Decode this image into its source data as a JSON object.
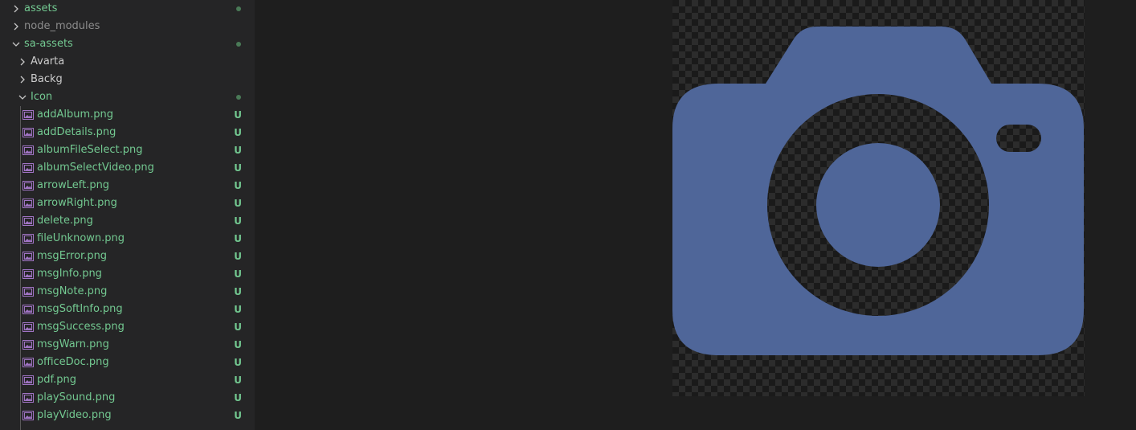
{
  "explorer": {
    "folders": [
      {
        "label": "assets",
        "expanded": false,
        "modified": true
      },
      {
        "label": "node_modules",
        "expanded": false,
        "modified": false
      },
      {
        "label": "sa-assets",
        "expanded": true,
        "modified": true
      }
    ],
    "subfolders": [
      {
        "label": "Avarta",
        "expanded": false
      },
      {
        "label": "Backg",
        "expanded": false
      },
      {
        "label": "Icon",
        "expanded": true,
        "modified": true
      }
    ],
    "files": [
      {
        "name": "addAlbum.png",
        "status": "U"
      },
      {
        "name": "addDetails.png",
        "status": "U"
      },
      {
        "name": "albumFileSelect.png",
        "status": "U"
      },
      {
        "name": "albumSelectVideo.png",
        "status": "U"
      },
      {
        "name": "arrowLeft.png",
        "status": "U"
      },
      {
        "name": "arrowRight.png",
        "status": "U"
      },
      {
        "name": "delete.png",
        "status": "U"
      },
      {
        "name": "fileUnknown.png",
        "status": "U"
      },
      {
        "name": "msgError.png",
        "status": "U"
      },
      {
        "name": "msgInfo.png",
        "status": "U"
      },
      {
        "name": "msgNote.png",
        "status": "U"
      },
      {
        "name": "msgSoftInfo.png",
        "status": "U"
      },
      {
        "name": "msgSuccess.png",
        "status": "U"
      },
      {
        "name": "msgWarn.png",
        "status": "U"
      },
      {
        "name": "officeDoc.png",
        "status": "U"
      },
      {
        "name": "pdf.png",
        "status": "U"
      },
      {
        "name": "playSound.png",
        "status": "U"
      },
      {
        "name": "playVideo.png",
        "status": "U"
      }
    ]
  },
  "preview": {
    "icon": "camera-icon",
    "icon_color": "#4f6699"
  },
  "colors": {
    "untracked": "#73c991",
    "folder_text": "#cccccc",
    "ignored_text": "#8c8c8c",
    "dot": "#4a7a57",
    "file_icon": "#a074c4",
    "guide": "#585858"
  }
}
